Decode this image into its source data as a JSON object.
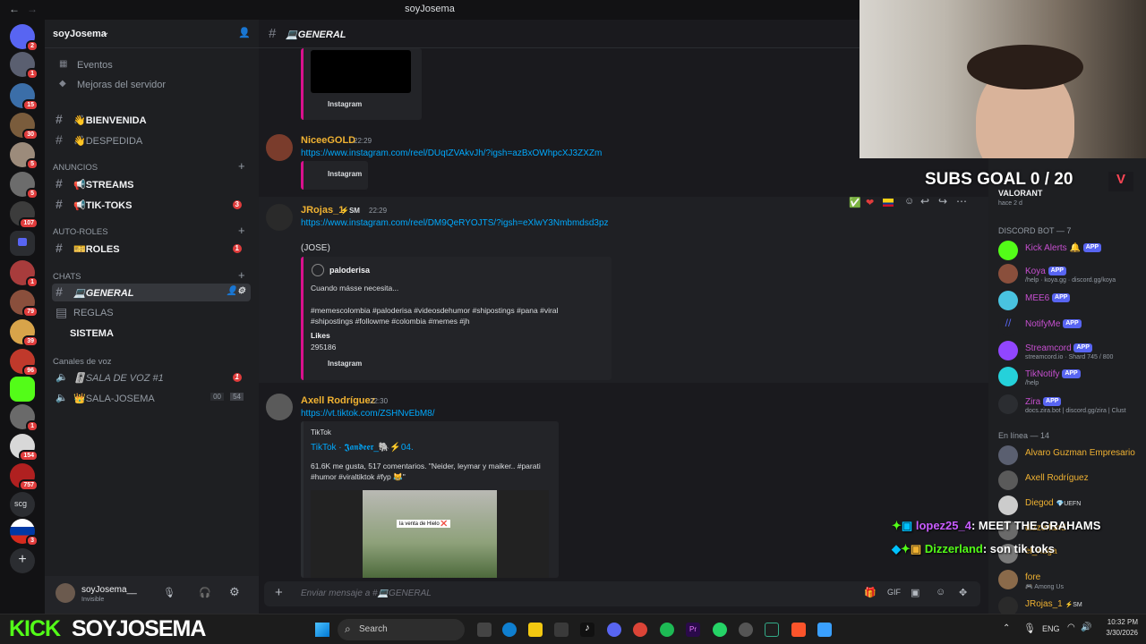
{
  "window_title": "soyJosema",
  "server": {
    "name": "soyJosema"
  },
  "rail_badges": [
    "2",
    "1",
    "15",
    "30",
    "5",
    "5",
    "107",
    "1",
    "79",
    "39",
    "96",
    "1",
    "154",
    "757",
    "3"
  ],
  "rail_scg": "scg",
  "channels": {
    "top": [
      "Eventos",
      "Mejoras del servidor"
    ],
    "general_list": [
      {
        "label": "👋BIENVENIDA"
      },
      {
        "label": "👋DESPEDIDA"
      }
    ],
    "cat_anuncios": "ANUNCIOS",
    "anuncios": [
      {
        "label": "📢STREAMS"
      },
      {
        "label": "📢TIK-TOKS",
        "count": "3"
      }
    ],
    "cat_autoroles": "AUTO-ROLES",
    "autoroles": [
      {
        "label": "🎫ROLES",
        "count": "1"
      }
    ],
    "cat_chats": "CHATS",
    "chats": [
      {
        "label": "💻GENERAL"
      },
      {
        "label": "REGLAS"
      },
      {
        "label": "SISTEMA"
      }
    ],
    "cat_voz": "Canales de voz",
    "voice": [
      {
        "label": "🎚️SALA DE VOZ #1",
        "count": "1"
      },
      {
        "label": "👑SALA-JOSEMA",
        "a": "00",
        "b": "54"
      }
    ]
  },
  "user": {
    "name": "soyJosema__",
    "status": "Invisible"
  },
  "chat": {
    "channel": "💻GENERAL",
    "input_placeholder": "Enviar mensaje a #💻GENERAL",
    "messages": [
      {
        "provider": "Instagram"
      },
      {
        "author": "NiceeGOLD",
        "time": "22:29",
        "link": "https://www.instagram.com/reel/DUqtZVAkvJh/?igsh=azBxOWhpcXJ3ZXZm",
        "provider": "Instagram"
      },
      {
        "author": "JRojas_1",
        "tag": "⚡SM",
        "time": "22:29",
        "link": "https://www.instagram.com/reel/DM9QeRYOJTS/?igsh=eXlwY3Nmbmdsd3pz",
        "text": "(JOSE)",
        "embed_author": "paloderisa",
        "embed_desc": "Cuando másse necesita...",
        "embed_tags": "#memescolombia #paloderisa #videosdehumor #shipostings #pana #viral #shipostings #followme #colombia #memes #jh",
        "likes_label": "Likes",
        "likes": "295186",
        "provider": "Instagram"
      },
      {
        "author": "Axell Rodríguez",
        "time": "22:30",
        "link": "https://vt.tiktok.com/ZSHNvEbM8/",
        "provider": "TikTok",
        "embed_title": "TikTok · 𝕵𝖆𝖓𝖉𝖊𝖊𝖗_🐘⚡04.",
        "embed_desc": "61.6K me gusta, 517 comentarios. \"Neider, leymar y maiker.. #parati #humor #viraltiktok #fyp 😹\"",
        "video_caption": "la venta de Hielo ❌"
      }
    ]
  },
  "members": {
    "top_game": "VALORANT",
    "top_sub": "hace 2 d",
    "bot_header": "DISCORD BOT — 7",
    "bots": [
      {
        "name": "Kick Alerts 🔔",
        "sub": "",
        "color": "#c64fcf"
      },
      {
        "name": "Koya",
        "sub": "/help · koya.gg · discord.gg/koya",
        "color": "#c64fcf"
      },
      {
        "name": "MEE6",
        "sub": "",
        "color": "#c64fcf"
      },
      {
        "name": "NotifyMe",
        "sub": "",
        "color": "#c64fcf"
      },
      {
        "name": "Streamcord",
        "sub": "streamcord.io · Shard 745 / 800",
        "color": "#c64fcf"
      },
      {
        "name": "TikNotify",
        "sub": "/help",
        "color": "#c64fcf"
      },
      {
        "name": "Zira",
        "sub": "docs.zira.bot | discord.gg/zira | Clust",
        "color": "#c64fcf"
      }
    ],
    "app_label": "APP",
    "online_header": "En línea — 14",
    "online": [
      {
        "name": "Alvaro Guzman Empresario",
        "sub": "",
        "color": "#f0b232"
      },
      {
        "name": "Axell Rodríguez",
        "sub": "",
        "color": "#f0b232"
      },
      {
        "name": "Diegod",
        "tag": "💎UEFN",
        "sub": "",
        "color": "#f0b232"
      },
      {
        "name": "dizzerland",
        "sub": "",
        "color": "#f0b232"
      },
      {
        "name": "el_nuga",
        "sub": "",
        "color": "#f0b232"
      },
      {
        "name": "fore",
        "sub": "🎮 Among Us",
        "color": "#f0b232"
      },
      {
        "name": "JRojas_1",
        "tag": "⚡SM",
        "sub": "",
        "color": "#f0b232"
      }
    ]
  },
  "stream_overlay": {
    "subs_goal": "SUBS GOAL 0 / 20",
    "chat_lines": [
      {
        "user": "lopez25_4",
        "text": ": MEET THE GRAHAMS",
        "user_color": "#c85cff"
      },
      {
        "user": "Dizzerland",
        "text": ": son tik toks",
        "user_color": "#53fc18"
      }
    ],
    "kick_brand": "KICK",
    "channel_brand": "SOYJOSEMA"
  },
  "taskbar": {
    "search_label": "Search",
    "lang": "ENG",
    "time": "10:32 PM",
    "date": "3/30/2026"
  }
}
